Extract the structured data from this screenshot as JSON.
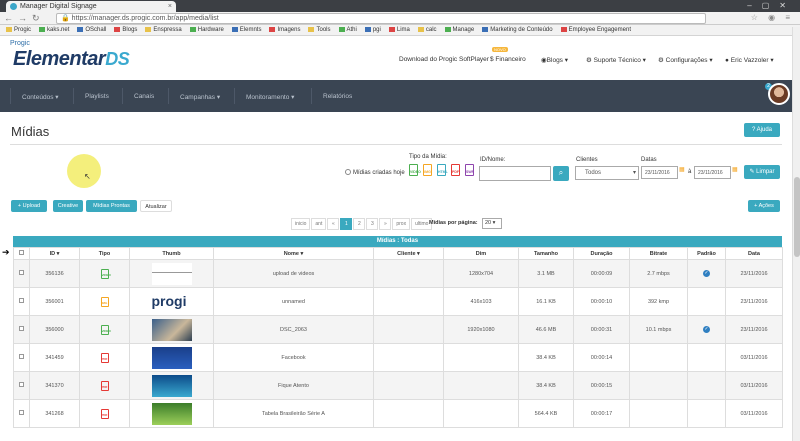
{
  "browser": {
    "tab_title": "Manager Digital Signage",
    "url": "https://manager.ds.progic.com.br/app/media/list",
    "url_secure": "https://",
    "bookmarks": [
      "Progic",
      "kaks.net",
      "OSchall",
      "Blogs",
      "Enspressa",
      "Hardware",
      "Elemnts",
      "Imagens",
      "Tools",
      "Athi",
      "pgi",
      "Lima",
      "calc",
      "Manage",
      "Marketing de Conteúdo",
      "Employee Engagement"
    ]
  },
  "header": {
    "brand_small": "Progic",
    "brand_main": "Elementar",
    "brand_suffix": "DS",
    "download": "Download do Progic SoftPlayer",
    "novo_badge": "NOVO",
    "financeiro": "Financeiro",
    "blogs": "Blogs",
    "suporte": "Suporte Técnico",
    "config": "Configurações",
    "user": "Eric Vazzoler",
    "notif_count": "2"
  },
  "nav": [
    "Conteúdos",
    "Playlists",
    "Canais",
    "Campanhas",
    "Monitoramento",
    "Relatórios"
  ],
  "page": {
    "title": "Mídias",
    "help_button": "Ajuda",
    "radio_label": "Mídias criadas hoje",
    "tipo_label": "Tipo da Mídia:",
    "types": [
      {
        "label": "VIDEO",
        "color": "#4caf50"
      },
      {
        "label": "IMG",
        "color": "#f5a623"
      },
      {
        "label": "HTML",
        "color": "#3aa9bf"
      },
      {
        "label": "PDF",
        "color": "#e53935"
      },
      {
        "label": "SWF",
        "color": "#8e44ad"
      }
    ],
    "id_nome_label": "ID/Nome:",
    "clientes_label": "Clientes",
    "clientes_value": "Todos",
    "datas_label": "Datas",
    "date_from": "23/11/2016",
    "date_to": "23/11/2016",
    "date_sep": "à",
    "limpar": "Limpar"
  },
  "toolbar": {
    "upload": "Upload",
    "creative": "Creative",
    "midias_prontas": "Mídias Prontas",
    "atualizar": "Atualizar",
    "acoes": "Ações"
  },
  "pager": {
    "items": [
      "inicio",
      "ant",
      "«",
      "1",
      "2",
      "3",
      "»",
      "prox",
      "ultimo"
    ],
    "active_index": 3,
    "per_page_label": "Mídias por página:",
    "per_page": "20"
  },
  "table": {
    "caption": "Mídias : Todas",
    "headers": [
      "",
      "ID",
      "Tipo",
      "Thumb",
      "Nome",
      "Cliente",
      "Dim",
      "Tamanho",
      "Duração",
      "Bitrate",
      "Padrão",
      "Data"
    ],
    "rows": [
      {
        "id": "356136",
        "tipo": "VIDEO",
        "tipo_color": "#4caf50",
        "thumb": "blank",
        "nome": "upload de videos",
        "cliente": "",
        "dim": "1280x704",
        "tamanho": "3.1 MB",
        "duracao": "00:00:09",
        "bitrate": "2.7 mbps",
        "padrao": true,
        "data": "23/11/2016"
      },
      {
        "id": "356001",
        "tipo": "IMG",
        "tipo_color": "#f5a623",
        "thumb": "progic",
        "nome": "unnamed",
        "cliente": "",
        "dim": "416x103",
        "tamanho": "16.1 KB",
        "duracao": "00:00:10",
        "bitrate": "392 kmp",
        "padrao": false,
        "data": "23/11/2016"
      },
      {
        "id": "356000",
        "tipo": "VIDEO",
        "tipo_color": "#4caf50",
        "thumb": "photo",
        "nome": "DSC_2063",
        "cliente": "",
        "dim": "1920x1080",
        "tamanho": "46.6 MB",
        "duracao": "00:00:31",
        "bitrate": "10.1 mbps",
        "padrao": true,
        "data": "23/11/2016"
      },
      {
        "id": "341459",
        "tipo": "PDF",
        "tipo_color": "#e53935",
        "thumb": "blue",
        "nome": "Facebook",
        "cliente": "",
        "dim": "",
        "tamanho": "38.4 KB",
        "duracao": "00:00:14",
        "bitrate": "",
        "padrao": false,
        "data": "03/11/2016"
      },
      {
        "id": "341370",
        "tipo": "PDF",
        "tipo_color": "#e53935",
        "thumb": "blue2",
        "nome": "Fique Atento",
        "cliente": "",
        "dim": "",
        "tamanho": "38.4 KB",
        "duracao": "00:00:15",
        "bitrate": "",
        "padrao": false,
        "data": "03/11/2016"
      },
      {
        "id": "341268",
        "tipo": "PDF",
        "tipo_color": "#e53935",
        "thumb": "green",
        "nome": "Tabela Brasileirão Série A",
        "cliente": "",
        "dim": "",
        "tamanho": "564.4 KB",
        "duracao": "00:00:17",
        "bitrate": "",
        "padrao": false,
        "data": "03/11/2016"
      }
    ]
  }
}
